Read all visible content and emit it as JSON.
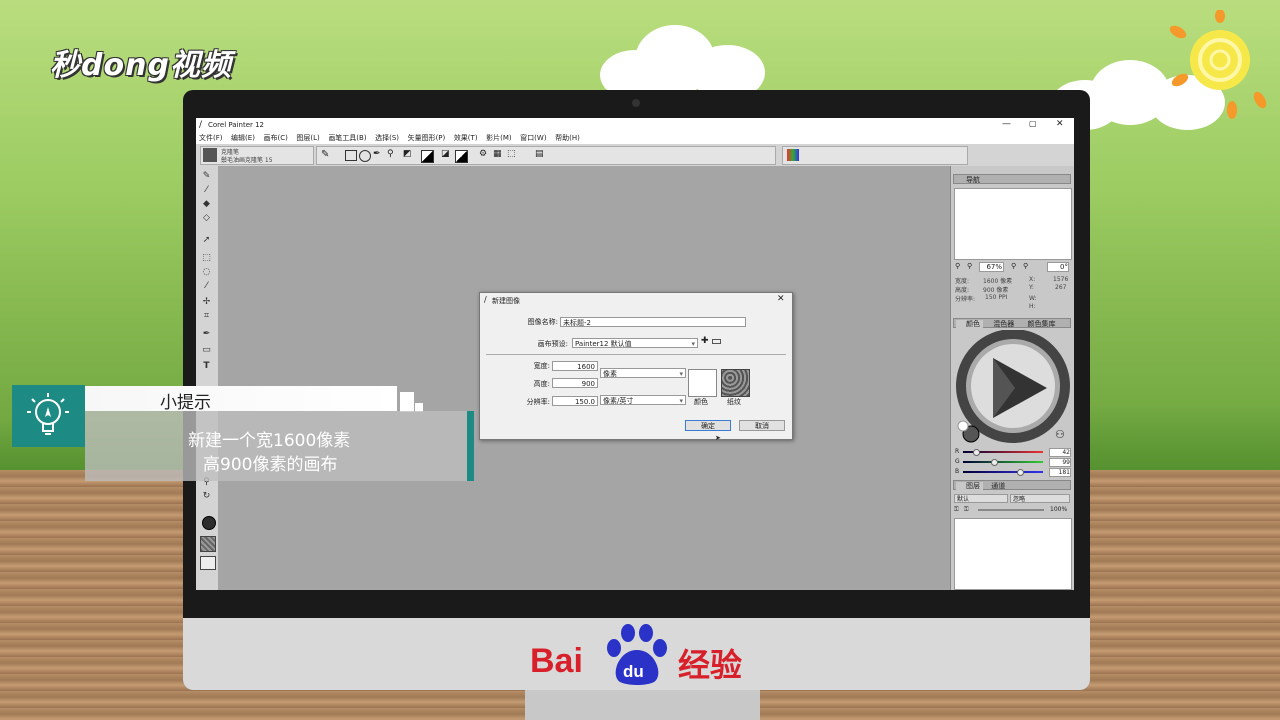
{
  "watermark": {
    "logo_text": "秒dong视频"
  },
  "app": {
    "title": "Corel Painter 12",
    "menu": [
      "文件(F)",
      "编辑(E)",
      "画布(C)",
      "图层(L)",
      "画笔工具(B)",
      "选择(S)",
      "矢量图形(P)",
      "效果(T)",
      "影片(M)",
      "窗口(W)",
      "帮助(H)"
    ],
    "brush_category": "克隆笔",
    "brush_variant": "鬃毛油画克隆笔 15"
  },
  "navigator": {
    "title": "导航",
    "zoom": "67%",
    "rotation": "0°",
    "info": {
      "width_label": "宽度:",
      "width_value": "1600 像素",
      "height_label": "高度:",
      "height_value": "900 像素",
      "res_label": "分辨率:",
      "res_value": "150 PPI",
      "x_label": "X:",
      "x_value": "1576",
      "y_label": "Y:",
      "y_value": "267",
      "w_label": "W:",
      "h_label": "H:"
    }
  },
  "color_panel": {
    "tabs": [
      "颜色",
      "混色器",
      "颜色集库"
    ],
    "r_label": "R",
    "r_value": "42",
    "r_fraction": 0.16,
    "g_label": "G",
    "g_value": "99",
    "g_fraction": 0.39,
    "b_label": "B",
    "b_value": "181",
    "b_fraction": 0.71
  },
  "layers_panel": {
    "tabs": [
      "图层",
      "通道"
    ],
    "blend": "默认",
    "composite": "忽略",
    "opacity": "100%"
  },
  "dialog": {
    "title": "新建图像",
    "name_label": "图像名称:",
    "name_value": "未标题-2",
    "preset_label": "画布预设:",
    "preset_value": "Painter12 默认值",
    "width_label": "宽度:",
    "width_value": "1600",
    "height_label": "高度:",
    "height_value": "900",
    "unit": "像素",
    "res_label": "分辨率:",
    "res_value": "150.0",
    "res_unit": "像素/英寸",
    "color_label": "颜色",
    "paper_label": "纸纹",
    "ok_label": "确定",
    "cancel_label": "取消"
  },
  "tip": {
    "title": "小提示",
    "line1": "新建一个宽1600像素",
    "line2": "高900像素的画布"
  },
  "brand": {
    "baidu_text": "Bai",
    "baidu_paw_text": "du",
    "jingyan": "经验"
  },
  "colors": {
    "accent": "#1e8a84",
    "baidu_red": "#d7202a",
    "baidu_blue": "#2a32c8"
  }
}
